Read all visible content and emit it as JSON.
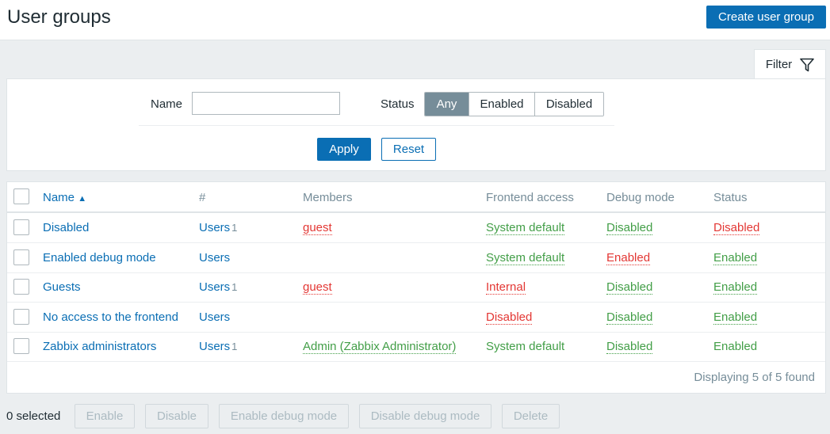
{
  "header": {
    "title": "User groups",
    "create_label": "Create user group"
  },
  "filter": {
    "tab_label": "Filter",
    "name_label": "Name",
    "name_value": "",
    "status_label": "Status",
    "status_options": [
      "Any",
      "Enabled",
      "Disabled"
    ],
    "status_selected": "Any",
    "apply_label": "Apply",
    "reset_label": "Reset"
  },
  "table": {
    "columns": [
      "Name",
      "#",
      "Members",
      "Frontend access",
      "Debug mode",
      "Status"
    ],
    "sort_indicator": "▲",
    "rows": [
      {
        "name": "Disabled",
        "users": "Users",
        "count": "1",
        "members": "guest",
        "frontend": "System default",
        "debug": "Disabled",
        "status": "Disabled"
      },
      {
        "name": "Enabled debug mode",
        "users": "Users",
        "count": "",
        "members": "",
        "frontend": "System default",
        "debug": "Enabled",
        "status": "Enabled"
      },
      {
        "name": "Guests",
        "users": "Users",
        "count": "1",
        "members": "guest",
        "frontend": "Internal",
        "debug": "Disabled",
        "status": "Enabled"
      },
      {
        "name": "No access to the frontend",
        "users": "Users",
        "count": "",
        "members": "",
        "frontend": "Disabled",
        "debug": "Disabled",
        "status": "Enabled"
      },
      {
        "name": "Zabbix administrators",
        "users": "Users",
        "count": "1",
        "members": "Admin (Zabbix Administrator)",
        "frontend": "System default",
        "debug": "Disabled",
        "status": "Enabled"
      }
    ],
    "footer": "Displaying 5 of 5 found"
  },
  "actions": {
    "selected": "0 selected",
    "buttons": [
      "Enable",
      "Disable",
      "Enable debug mode",
      "Disable debug mode",
      "Delete"
    ]
  },
  "colors": {
    "accent": "#0a6eb4",
    "green": "#429e47",
    "red": "#e33734",
    "muted": "#768d99"
  }
}
